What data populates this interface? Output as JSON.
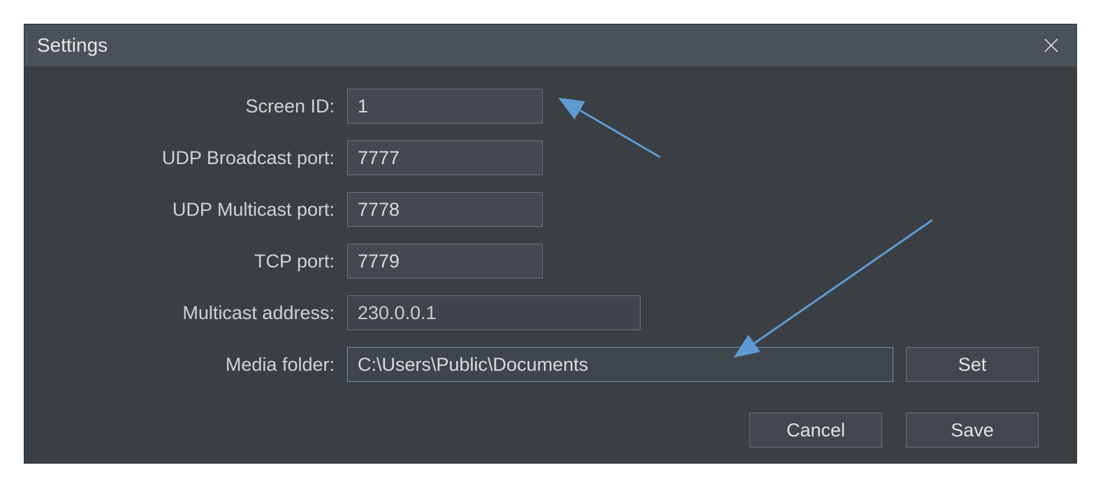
{
  "dialog": {
    "title": "Settings",
    "fields": {
      "screen_id": {
        "label": "Screen ID:",
        "value": "1"
      },
      "udp_broadcast_port": {
        "label": "UDP Broadcast port:",
        "value": "7777"
      },
      "udp_multicast_port": {
        "label": "UDP Multicast port:",
        "value": "7778"
      },
      "tcp_port": {
        "label": "TCP port:",
        "value": "7779"
      },
      "multicast_address": {
        "label": "Multicast address:",
        "value": "230.0.0.1"
      },
      "media_folder": {
        "label": "Media folder:",
        "value": "C:\\Users\\Public\\Documents"
      }
    },
    "buttons": {
      "set": "Set",
      "cancel": "Cancel",
      "save": "Save"
    }
  },
  "annotations": {
    "arrow_color": "#5e9bd3"
  }
}
